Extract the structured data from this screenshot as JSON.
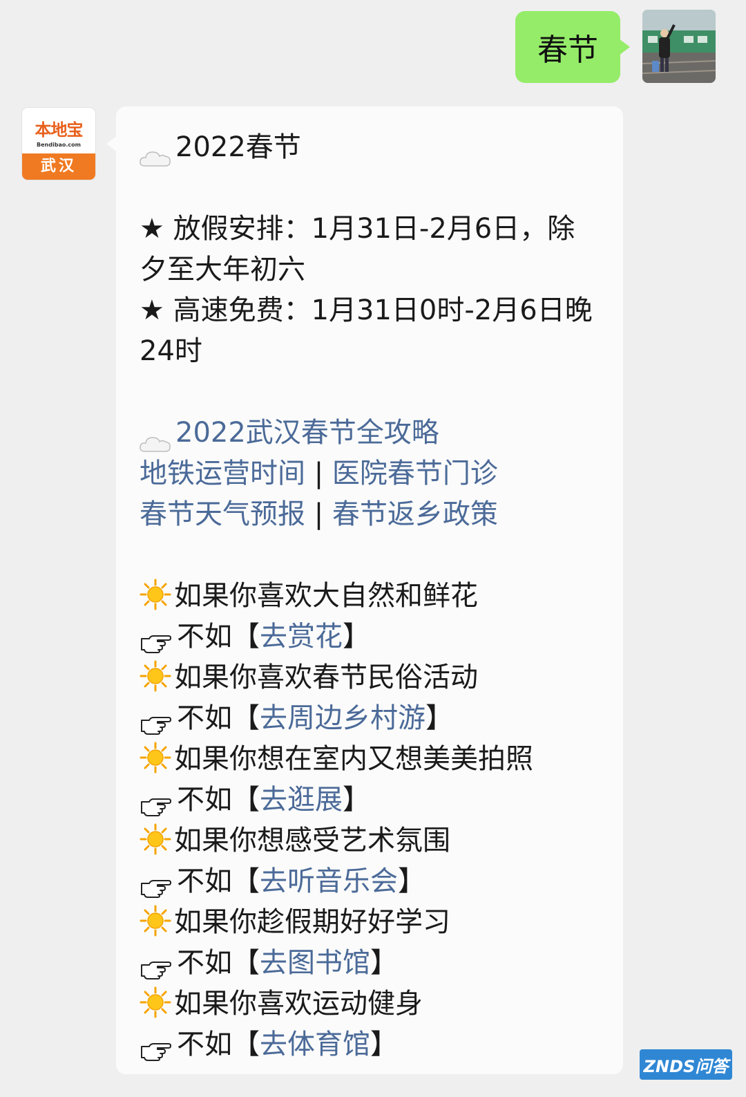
{
  "outgoing": {
    "text": "春节"
  },
  "sender": {
    "logo_name": "本地宝",
    "logo_domain": "Bendibao.com",
    "logo_city": "武汉"
  },
  "message": {
    "title": "2022春节",
    "holiday_line1": "★ 放假安排：1月31日-2月6日，除夕至大年初六",
    "toll_line": "★ 高速免费：1月31日0时-2月6日晚24时",
    "guide_title": "2022武汉春节全攻略",
    "links_row1": [
      "地铁运营时间",
      "医院春节门诊"
    ],
    "links_row2": [
      "春节天气预报",
      "春节返乡政策"
    ],
    "separator": "|",
    "suggestions": [
      {
        "if": "如果你喜欢大自然和鲜花",
        "prefix": "不如【",
        "link": "去赏花",
        "suffix": "】"
      },
      {
        "if": "如果你喜欢春节民俗活动",
        "prefix": "不如【",
        "link": "去周边乡村游",
        "suffix": "】"
      },
      {
        "if": "如果你想在室内又想美美拍照",
        "prefix": "不如【",
        "link": "去逛展",
        "suffix": "】"
      },
      {
        "if": "如果你想感受艺术氛围",
        "prefix": "不如【",
        "link": "去听音乐会",
        "suffix": "】"
      },
      {
        "if": "如果你趁假期好好学习",
        "prefix": "不如【",
        "link": "去图书馆",
        "suffix": "】"
      },
      {
        "if": "如果你喜欢运动健身",
        "prefix": "不如【",
        "link": "去体育馆",
        "suffix": "】"
      }
    ]
  },
  "watermark": {
    "text": "ZNDS问答"
  },
  "colors": {
    "outgoing_bubble": "#95ec69",
    "link": "#4b6a98",
    "logo_orange": "#f07a22",
    "watermark": "#2f87d4"
  }
}
